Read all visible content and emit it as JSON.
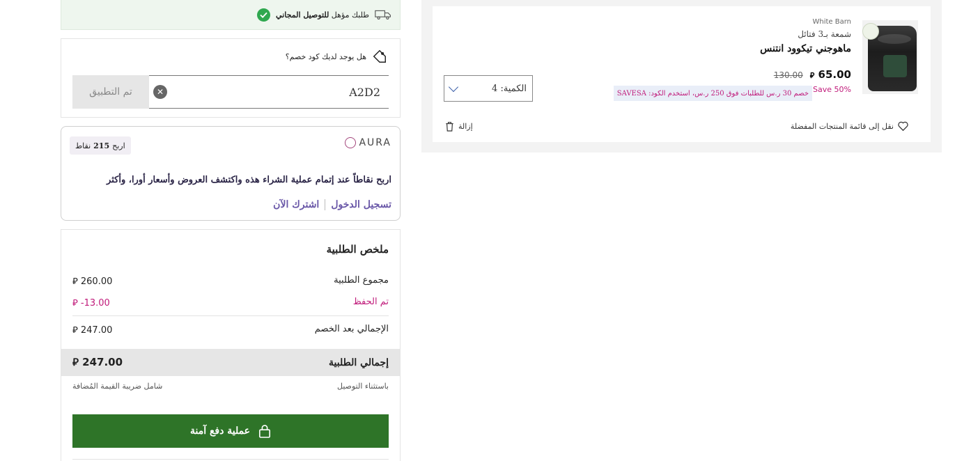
{
  "cart": {
    "brand": "White Barn",
    "subtitle": "شمعة بـ3 فتائل",
    "name": "ماهوجني تيكوود انتنس",
    "price_new": "65.00",
    "price_old": "130.00",
    "currency_symbol": "⃁",
    "save_percent": "Save 50%",
    "promo_text": "خصم 30 ر.س للطلبات فوق 250 ر.س، استخدم الكود: SAVESA",
    "quantity_label": "الكمية: 4",
    "move_to_wishlist": "نقل إلى قائمة المنتجات المفضلة",
    "remove": "إزالة"
  },
  "shipping": {
    "prefix": "طلبك مؤهل ",
    "highlight": "للتوصيل المجاني"
  },
  "coupon": {
    "question": "هل يوجد لديك كود خصم؟",
    "value": "A2D2",
    "apply_label": "تم التطبيق"
  },
  "aura": {
    "logo_text": "AURA",
    "points_prefix": "اربح",
    "points_value": "215",
    "points_suffix": "نقاط",
    "message": "اربح نقاطاً عند إتمام عملية الشراء هذه واكتشف العروض وأسعار أورا، وأكثر",
    "login": "تسجيل الدخول",
    "signup": "اشترك الآن"
  },
  "summary": {
    "title": "ملخص الطلبية",
    "subtotal_label": "مجموع الطلبية",
    "subtotal_value": "260.00",
    "saved_label": "تم الحفظ",
    "saved_value": "-13.00",
    "after_discount_label": "الإجمالي بعد الخصم",
    "after_discount_value": "247.00",
    "total_label": "إجمالي الطلبية",
    "total_value": "247.00",
    "shipping_note": "باستثناء التوصيل",
    "tax_note": "شامل ضريبة القيمة المُضافة",
    "checkout_label": "عملية دفع آمنة"
  },
  "colors": {
    "accent_green": "#2e7428",
    "promo_pink": "#c01a7a",
    "aura_purple": "#6a58a8"
  }
}
